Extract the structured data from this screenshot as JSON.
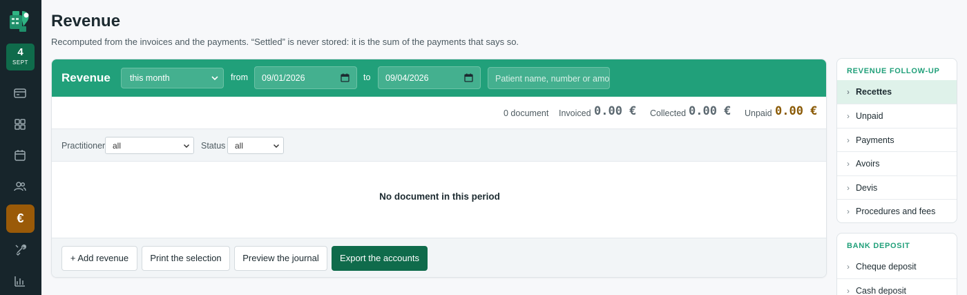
{
  "rail": {
    "date_day": "4",
    "date_month": "SEPT",
    "icons": [
      "billing-card-icon",
      "dashboard-grid-icon",
      "calendar-icon",
      "patients-icon",
      "euro-icon",
      "tools-icon",
      "stats-icon"
    ],
    "active_symbol": "€"
  },
  "header": {
    "title": "Revenue",
    "subtitle": "Recomputed from the invoices and the payments. “Settled” is never stored: it is the sum of the payments that says so."
  },
  "panel": {
    "title": "Revenue",
    "period_value": "this month",
    "from_label": "from",
    "from_date": "09/01/2026",
    "to_label": "to",
    "to_date": "09/04/2026",
    "search_placeholder": "Patient name, number or amount"
  },
  "totals": {
    "count": "0 document",
    "invoiced_label": "Invoiced",
    "invoiced_value": "0.00 €",
    "collected_label": "Collected",
    "collected_value": "0.00 €",
    "unpaid_label": "Unpaid",
    "unpaid_value": "0.00 €"
  },
  "filters": {
    "practitioner_label": "Practitioner",
    "practitioner_value": "all",
    "status_label": "Status",
    "status_value": "all"
  },
  "empty_message": "No document in this period",
  "actions": {
    "add": "+ Add revenue",
    "print": "Print the selection",
    "preview": "Preview the journal",
    "export": "Export the accounts"
  },
  "sidebar": {
    "follow_up_title": "REVENUE FOLLOW-UP",
    "follow_up_items": [
      "Recettes",
      "Unpaid",
      "Payments",
      "Avoirs",
      "Devis",
      "Procedures and fees"
    ],
    "bank_title": "BANK DEPOSIT",
    "bank_items": [
      "Cheque deposit",
      "Cash deposit"
    ]
  },
  "colors": {
    "brand_green": "#21a07a",
    "dark_green": "#0f6b4b",
    "rail_bg": "#17252b",
    "active_orange": "#9a5a08",
    "unpaid_amber": "#8a5a06"
  }
}
